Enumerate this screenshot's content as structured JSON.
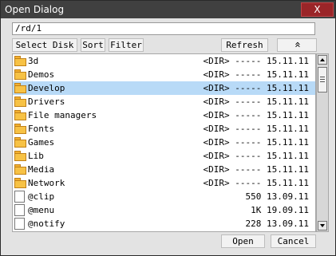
{
  "window": {
    "title": "Open Dialog",
    "close_label": "X"
  },
  "path_value": "/rd/1",
  "toolbar": {
    "select_disk": "Select Disk",
    "sort": "Sort",
    "filter": "Filter",
    "refresh": "Refresh",
    "up_folder": "«"
  },
  "files": [
    {
      "name": "3d",
      "type": "dir",
      "info": "<DIR> ----- 15.11.11"
    },
    {
      "name": "Demos",
      "type": "dir",
      "info": "<DIR> ----- 15.11.11"
    },
    {
      "name": "Develop",
      "type": "dir",
      "info": "<DIR> ----- 15.11.11",
      "selected": true
    },
    {
      "name": "Drivers",
      "type": "dir",
      "info": "<DIR> ----- 15.11.11"
    },
    {
      "name": "File managers",
      "type": "dir",
      "info": "<DIR> ----- 15.11.11"
    },
    {
      "name": "Fonts",
      "type": "dir",
      "info": "<DIR> ----- 15.11.11"
    },
    {
      "name": "Games",
      "type": "dir",
      "info": "<DIR> ----- 15.11.11"
    },
    {
      "name": "Lib",
      "type": "dir",
      "info": "<DIR> ----- 15.11.11"
    },
    {
      "name": "Media",
      "type": "dir",
      "info": "<DIR> ----- 15.11.11"
    },
    {
      "name": "Network",
      "type": "dir",
      "info": "<DIR> ----- 15.11.11"
    },
    {
      "name": "@clip",
      "type": "file",
      "info": "550 13.09.11"
    },
    {
      "name": "@menu",
      "type": "file",
      "info": "1K 19.09.11"
    },
    {
      "name": "@notify",
      "type": "file",
      "info": "228 13.09.11"
    }
  ],
  "actions": {
    "open": "Open",
    "cancel": "Cancel"
  }
}
